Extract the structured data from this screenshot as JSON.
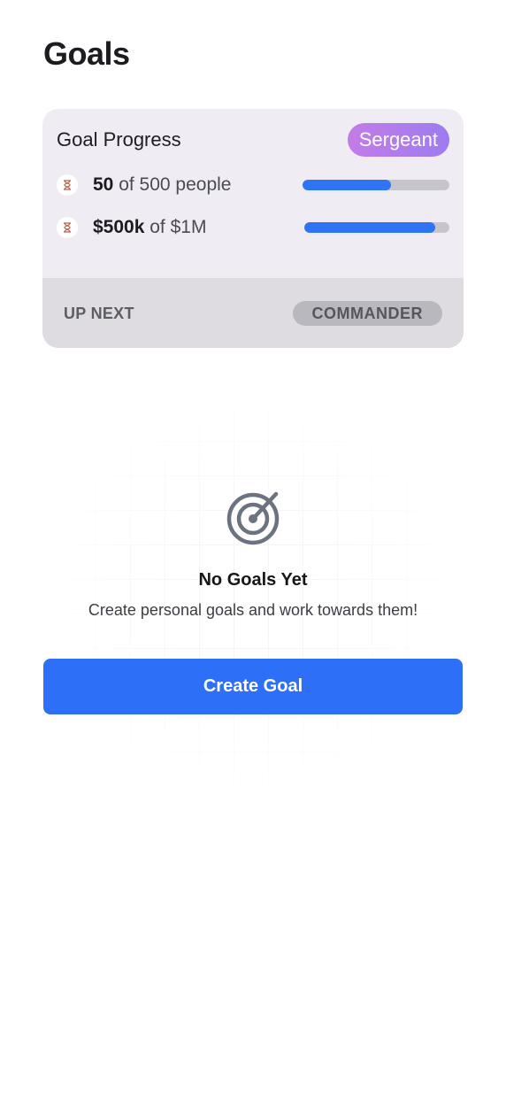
{
  "page": {
    "title": "Goals"
  },
  "progress_card": {
    "title": "Goal Progress",
    "rank": "Sergeant",
    "metrics": [
      {
        "icon": "hourglass-icon",
        "value": "50",
        "rest": "of 500 people",
        "progress": 0.6
      },
      {
        "icon": "hourglass-icon",
        "value": "$500k",
        "rest": "of $1M",
        "progress": 0.9
      }
    ],
    "footer": {
      "label": "UP NEXT",
      "next_rank": "COMMANDER"
    }
  },
  "empty_state": {
    "icon": "target-icon",
    "title": "No Goals Yet",
    "subtitle": "Create personal goals and work towards them!",
    "button_label": "Create Goal"
  },
  "colors": {
    "accent": "#2d6ff6",
    "progress_fill": "#2f74f4",
    "rank_gradient_start": "#c37ce8",
    "rank_gradient_end": "#9d7cf0"
  }
}
